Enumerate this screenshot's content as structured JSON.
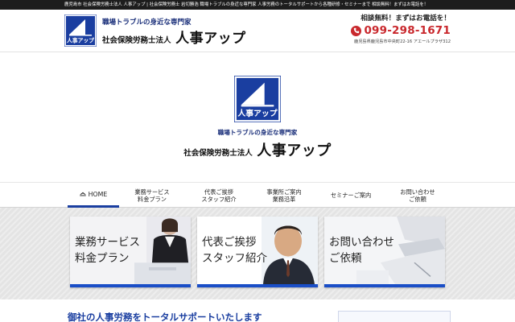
{
  "topbar": {
    "text": "鹿児島市 社会保険労務士法人 人事アップ | 社会保険労務士 岩切勝浩 職場トラブルの身近な専門家 人事労務のトータルサポートから各種研修・セミナーまで 相談無料！まずはお電話を！"
  },
  "header": {
    "logo_text": "人事アップ",
    "tagline": "職場トラブルの身近な専門家",
    "corp_prefix": "社会保険労務士法人",
    "corp_name": "人事アップ",
    "contact_lead": "相談無料！まずはお電話を！",
    "phone": "099-298-1671",
    "address": "鹿児島県鹿児島市中央町22-16 アエールプラザ312"
  },
  "hero": {
    "logo_text": "人事アップ",
    "tagline": "職場トラブルの身近な専門家",
    "corp_prefix": "社会保険労務士法人",
    "corp_name": "人事アップ"
  },
  "nav": {
    "items": [
      {
        "label": "HOME"
      },
      {
        "label": "業務サービス\n料金プラン"
      },
      {
        "label": "代表ご挨拶\nスタッフ紹介"
      },
      {
        "label": "事業所ご案内\n業務沿革"
      },
      {
        "label": "セミナーご案内"
      },
      {
        "label": "お問い合わせ\nご依頼"
      }
    ]
  },
  "cards": [
    {
      "label": "業務サービス\n料金プラン"
    },
    {
      "label": "代表ご挨拶\nスタッフ紹介"
    },
    {
      "label": "お問い合わせ\nご依頼"
    }
  ],
  "bottom": {
    "title": "御社の人事労務をトータルサポートいたします"
  },
  "colors": {
    "brand_blue": "#1a3ea0",
    "card_border": "#1a4ec7",
    "phone_red": "#c9282d",
    "topbar": "#1d1d1d"
  },
  "icons": [
    "logo-icon",
    "phone-icon",
    "home-icon"
  ]
}
